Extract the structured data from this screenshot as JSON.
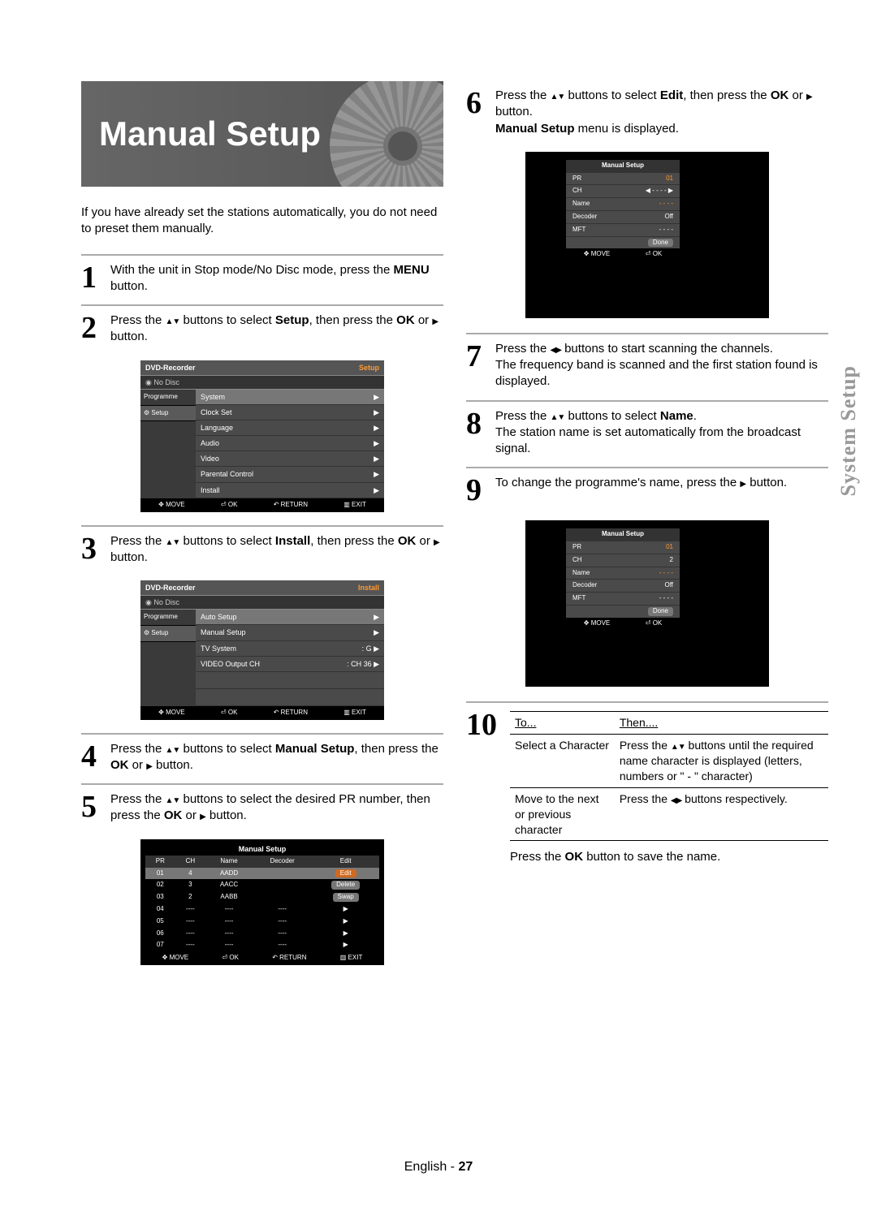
{
  "section_side_label": "System Setup",
  "footer": {
    "lang": "English",
    "page": "27"
  },
  "header": {
    "title": "Manual Setup"
  },
  "intro": "If you have already set the stations automatically, you do not need to preset them manually.",
  "steps": {
    "s1": {
      "n": "1",
      "pre": "With the unit in Stop mode/No Disc mode, press the ",
      "b": "MENU",
      "post": " button."
    },
    "s2": {
      "n": "2",
      "pre": "Press the ",
      "mid": " buttons to select ",
      "b1": "Setup",
      "post": ", then press the ",
      "b2": "OK",
      "post2": " or ",
      "post3": " button."
    },
    "s3": {
      "n": "3",
      "pre": "Press the ",
      "mid": " buttons to select ",
      "b1": "Install",
      "post": ", then press the ",
      "b2": "OK",
      "post2": " or ",
      "post3": " button."
    },
    "s4": {
      "n": "4",
      "pre": "Press the ",
      "mid": " buttons to select ",
      "b1": "Manual Setup",
      "post": ", then press the ",
      "b2": "OK",
      "post2": " or ",
      "post3": " button."
    },
    "s5": {
      "n": "5",
      "pre": "Press the ",
      "mid": " buttons to select the desired PR number, then press the ",
      "b2": "OK",
      "post2": " or ",
      "post3": " button."
    },
    "s6": {
      "n": "6",
      "pre": "Press the ",
      "mid": " buttons to select ",
      "b1": "Edit",
      "post": ", then press the ",
      "b2": "OK",
      "post2": " or ",
      "post3": " button.",
      "extra_b": "Manual Setup",
      "extra_post": " menu is displayed."
    },
    "s7": {
      "n": "7",
      "pre": "Press the ",
      "mid": " buttons to start scanning the channels.",
      "post": "The frequency band is scanned and the first station found is displayed."
    },
    "s8": {
      "n": "8",
      "pre": "Press the ",
      "mid": " buttons to select ",
      "b1": "Name",
      "post": ".",
      "post2": "The station name is set automatically from the broadcast signal."
    },
    "s9": {
      "n": "9",
      "pre": "To change the programme's name, press the ",
      "post": " button."
    },
    "s10": {
      "n": "10",
      "th1": "To...",
      "th2": "Then....",
      "r1a": "Select a Character",
      "r1b_pre": "Press the ",
      "r1b_post": " buttons until the required name character is displayed (letters, numbers or \" - \" character)",
      "r2a": "Move to the next or previous character",
      "r2b_pre": "Press the ",
      "r2b_post": " buttons respectively.",
      "final_pre": "Press the ",
      "final_b": "OK",
      "final_post": " button to save the name."
    }
  },
  "osd_setup": {
    "title": "DVD-Recorder",
    "corner": "Setup",
    "nodisc": "No Disc",
    "side": [
      "Programme",
      "Setup"
    ],
    "items": [
      "System",
      "Clock Set",
      "Language",
      "Audio",
      "Video",
      "Parental Control",
      "Install"
    ],
    "footer": [
      "MOVE",
      "OK",
      "RETURN",
      "EXIT"
    ]
  },
  "osd_install": {
    "title": "DVD-Recorder",
    "corner": "Install",
    "nodisc": "No Disc",
    "side": [
      "Programme",
      "Setup"
    ],
    "items": [
      {
        "l": "Auto Setup",
        "r": "▶",
        "sel": true
      },
      {
        "l": "Manual Setup",
        "r": "▶"
      },
      {
        "l": "TV System",
        "r": ": G   ▶"
      },
      {
        "l": "VIDEO Output CH",
        "r": ": CH 36   ▶"
      }
    ],
    "footer": [
      "MOVE",
      "OK",
      "RETURN",
      "EXIT"
    ]
  },
  "osd_prlist": {
    "title": "Manual Setup",
    "cols": [
      "PR",
      "CH",
      "Name",
      "Decoder",
      "Edit"
    ],
    "rows": [
      [
        "01",
        "4",
        "AADD",
        "Edit",
        "orange"
      ],
      [
        "02",
        "3",
        "AACC",
        "Delete",
        ""
      ],
      [
        "03",
        "2",
        "AABB",
        "Swap",
        ""
      ],
      [
        "04",
        "----",
        "----",
        "----",
        "▶"
      ],
      [
        "05",
        "----",
        "----",
        "----",
        "▶"
      ],
      [
        "06",
        "----",
        "----",
        "----",
        "▶"
      ],
      [
        "07",
        "----",
        "----",
        "----",
        "▶"
      ]
    ],
    "footer": [
      "MOVE",
      "OK",
      "RETURN",
      "EXIT"
    ]
  },
  "osd_edit1": {
    "title": "Manual Setup",
    "rows": [
      [
        "PR",
        "01"
      ],
      [
        "CH",
        "◀ - - - - ▶"
      ],
      [
        "Name",
        "- - - -"
      ],
      [
        "Decoder",
        "Off"
      ],
      [
        "MFT",
        "- - - -"
      ],
      [
        "",
        "Done"
      ]
    ],
    "footer": [
      "MOVE",
      "OK"
    ]
  },
  "osd_edit2": {
    "title": "Manual Setup",
    "rows": [
      [
        "PR",
        "01"
      ],
      [
        "CH",
        "2"
      ],
      [
        "Name",
        "- - - -"
      ],
      [
        "Decoder",
        "Off"
      ],
      [
        "MFT",
        "- - - -"
      ],
      [
        "",
        "Done"
      ]
    ],
    "footer": [
      "MOVE",
      "OK"
    ]
  }
}
